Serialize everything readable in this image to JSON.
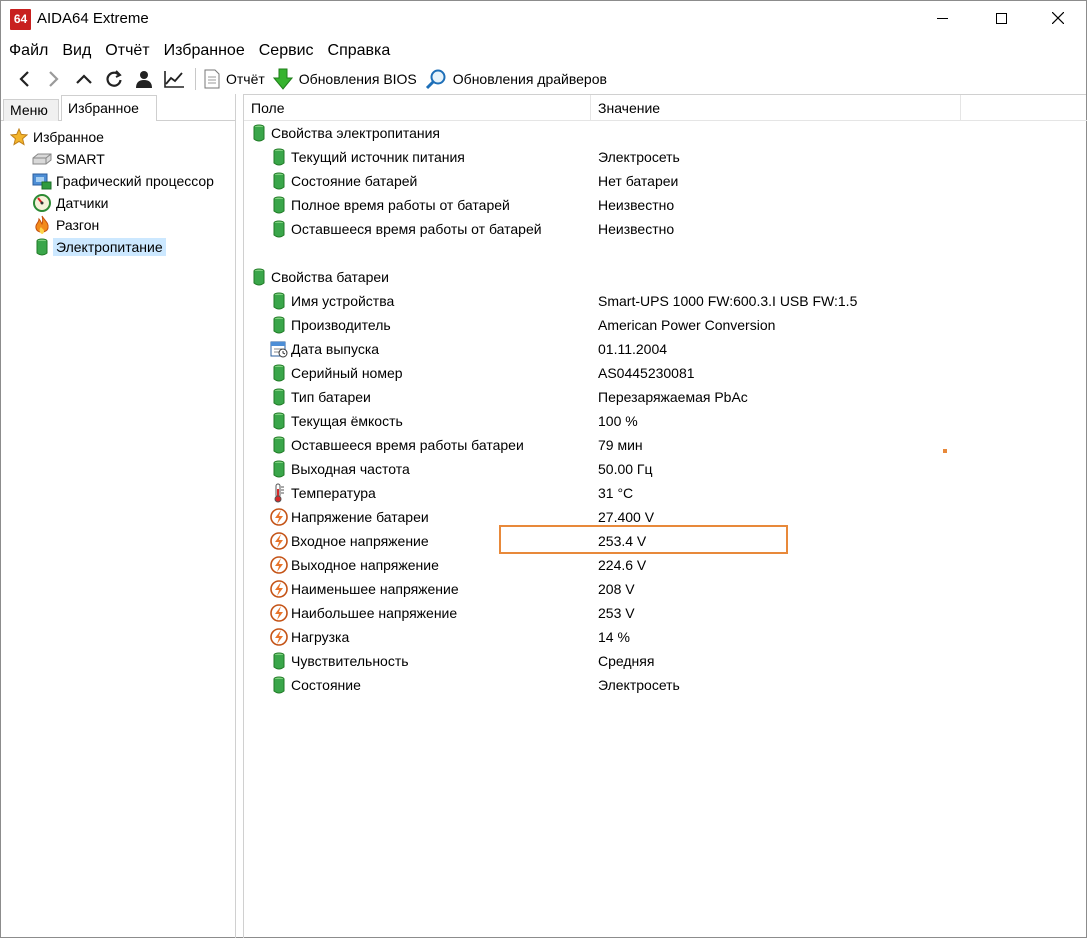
{
  "app": {
    "icon_text": "64",
    "title": "AIDA64 Extreme"
  },
  "menu": [
    "Файл",
    "Вид",
    "Отчёт",
    "Избранное",
    "Сервис",
    "Справка"
  ],
  "toolbar": {
    "report_label": "Отчёт",
    "bios_label": "Обновления BIOS",
    "drivers_label": "Обновления драйверов"
  },
  "left_tabs": {
    "menu_label": "Меню",
    "favorites_label": "Избранное"
  },
  "tree": {
    "root": "Избранное",
    "items": [
      "SMART",
      "Графический процессор",
      "Датчики",
      "Разгон",
      "Электропитание"
    ]
  },
  "columns": {
    "field": "Поле",
    "value": "Значение"
  },
  "sections": [
    {
      "title": "Свойства электропитания",
      "rows": [
        {
          "field": "Текущий источник питания",
          "value": "Электросеть"
        },
        {
          "field": "Состояние батарей",
          "value": "Нет батареи"
        },
        {
          "field": "Полное время работы от батарей",
          "value": "Неизвестно"
        },
        {
          "field": "Оставшееся время работы от батарей",
          "value": "Неизвестно"
        }
      ]
    },
    {
      "title": "Свойства батареи",
      "rows": [
        {
          "field": "Имя устройства",
          "value": "Smart-UPS 1000 FW:600.3.I USB FW:1.5"
        },
        {
          "field": "Производитель",
          "value": "American Power Conversion"
        },
        {
          "field": "Дата выпуска",
          "value": "01.11.2004"
        },
        {
          "field": "Серийный номер",
          "value": "AS0445230081"
        },
        {
          "field": "Тип батареи",
          "value": "Перезаряжаемая PbAc"
        },
        {
          "field": "Текущая ёмкость",
          "value": "100 %"
        },
        {
          "field": "Оставшееся время работы батареи",
          "value": "79 мин"
        },
        {
          "field": "Выходная частота",
          "value": "50.00 Гц"
        },
        {
          "field": "Температура",
          "value": "31 °C"
        },
        {
          "field": "Напряжение батареи",
          "value": "27.400 V"
        },
        {
          "field": "Входное напряжение",
          "value": "253.4 V"
        },
        {
          "field": "Выходное напряжение",
          "value": "224.6 V"
        },
        {
          "field": "Наименьшее напряжение",
          "value": "208 V"
        },
        {
          "field": "Наибольшее напряжение",
          "value": "253 V"
        },
        {
          "field": "Нагрузка",
          "value": "14 %"
        },
        {
          "field": "Чувствительность",
          "value": "Средняя"
        },
        {
          "field": "Состояние",
          "value": "Электросеть"
        }
      ]
    }
  ],
  "colors": {
    "highlight": "#e8893a",
    "selected_bg": "#cce8ff",
    "battery_green": "#3aa64a"
  }
}
